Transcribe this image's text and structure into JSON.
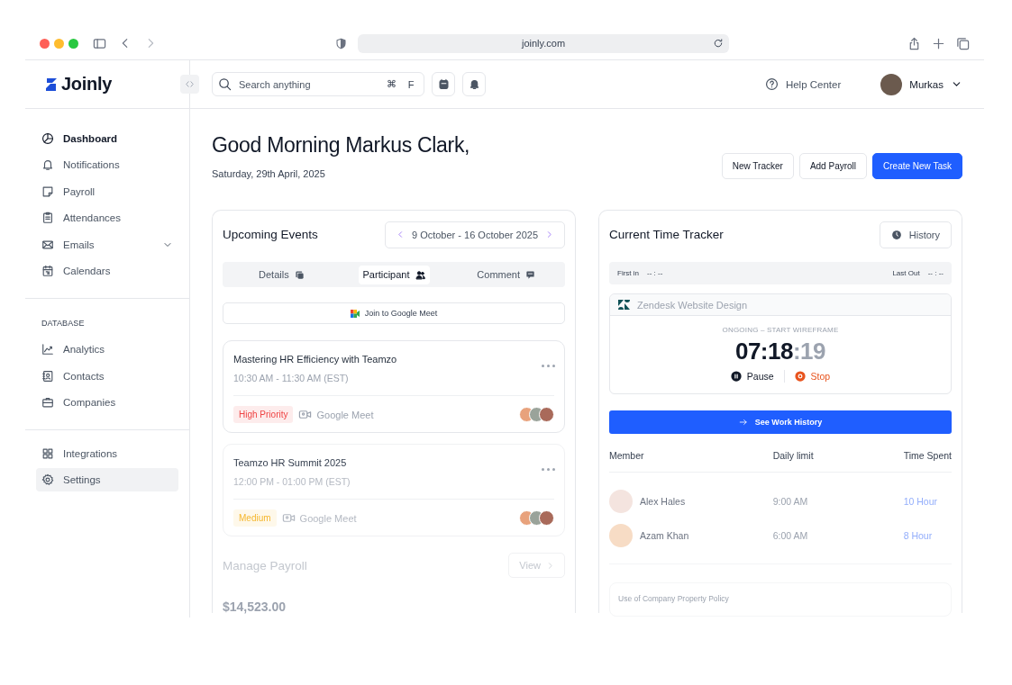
{
  "browser": {
    "url": "joinly.com"
  },
  "brand": {
    "name": "Joinly"
  },
  "search": {
    "placeholder": "Search anything",
    "keys": [
      "⌘",
      "F"
    ]
  },
  "header": {
    "help": "Help Center",
    "user": "Murkas"
  },
  "sidebar": {
    "groups": [
      {
        "items": [
          {
            "label": "Dashboard",
            "selected": true,
            "hovered": false
          },
          {
            "label": "Notifications",
            "selected": false,
            "hovered": false
          },
          {
            "label": "Payroll",
            "selected": false,
            "hovered": false
          },
          {
            "label": "Attendances",
            "selected": false,
            "hovered": false
          },
          {
            "label": "Emails",
            "selected": false,
            "hovered": false,
            "expanded": false
          },
          {
            "label": "Calendars",
            "selected": false,
            "hovered": false
          }
        ]
      },
      {
        "heading": "DATABASE",
        "items": [
          {
            "label": "Analytics",
            "selected": false,
            "hovered": false
          },
          {
            "label": "Contacts",
            "selected": false,
            "hovered": false
          },
          {
            "label": "Companies",
            "selected": false,
            "hovered": false
          }
        ]
      },
      {
        "items": [
          {
            "label": "Integrations",
            "selected": false,
            "hovered": false
          },
          {
            "label": "Settings",
            "selected": false,
            "hovered": true
          }
        ]
      }
    ]
  },
  "greeting": {
    "title": "Good Morning Markus Clark,",
    "date": "Saturday, 29th April, 2025"
  },
  "actions": [
    {
      "label": "New Tracker",
      "kind": "secondary"
    },
    {
      "label": "Add Payroll",
      "kind": "secondary"
    },
    {
      "label": "Create New Task",
      "kind": "primary"
    }
  ],
  "events": {
    "title": "Upcoming Events",
    "range": "9 October - 16 October 2025",
    "tabs": [
      {
        "label": "Details",
        "selected": false
      },
      {
        "label": "Participant",
        "selected": true
      },
      {
        "label": "Comment",
        "selected": false
      }
    ],
    "join": "Join to Google Meet",
    "items": [
      {
        "title": "Mastering HR Efficiency with Teamzo",
        "time": "10:30 AM - 11:30 AM (EST)",
        "priority": "High Priority",
        "color": "#ef4444",
        "platform": "Google Meet"
      },
      {
        "title": "Teamzo HR Summit 2025",
        "time": "12:00 PM - 01:00 PM (EST)",
        "priority": "Medium",
        "color": "#f5b72e",
        "platform": "Google Meet"
      }
    ]
  },
  "payroll": {
    "title": "Manage Payroll",
    "view": "View",
    "amount": "$14,523.00"
  },
  "tracker": {
    "title": "Current Time Tracker",
    "history": "History",
    "first_in_label": "First in",
    "first_in": "-- : --",
    "last_out_label": "Last Out",
    "last_out": "-- : --",
    "project": "Zendesk Website Design",
    "status": "ONGOING – START WIREFRAME",
    "time_main": "07:18",
    "time_seconds": ":19",
    "pause": "Pause",
    "stop": "Stop",
    "see_history": "See Work History",
    "columns": [
      "Member",
      "Daily limit",
      "Time Spent"
    ],
    "rows": [
      {
        "name": "Alex Hales",
        "limit": "9:00 AM",
        "spent": "10 Hour"
      },
      {
        "name": "Azam Khan",
        "limit": "6:00 AM",
        "spent": "8 Hour"
      }
    ],
    "policy": "Use of Company Property Policy"
  }
}
